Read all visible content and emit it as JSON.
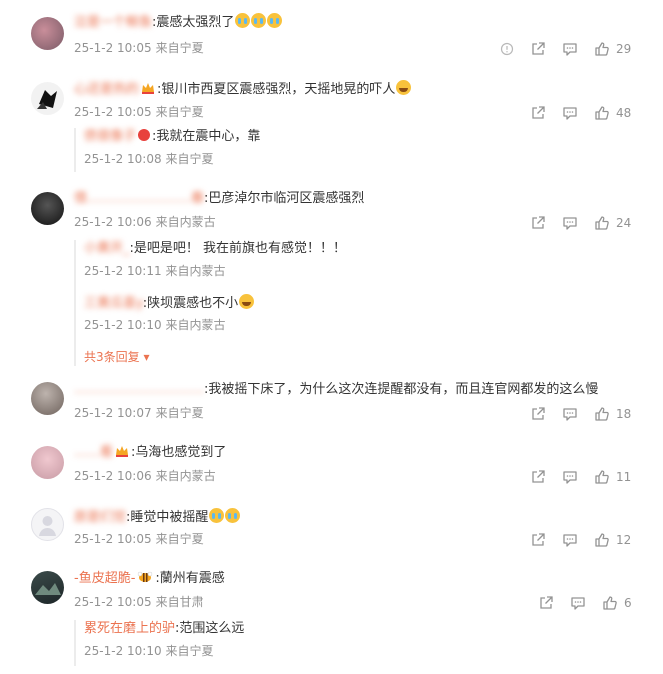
{
  "comments": [
    {
      "user": "泣是一个鲸鱼",
      "text": ":震感太强烈了",
      "emojis": [
        "cry-emoji",
        "cry-emoji",
        "cry-emoji"
      ],
      "time": "25-1-2 10:05",
      "source": "来自宁夏",
      "likes": "29",
      "has_report": true
    },
    {
      "user": "心还是热的",
      "badge": "crown-icon",
      "text": ":银川市西夏区震感强烈，天摇地晃的吓人",
      "emojis": [
        "laugh-cry-emoji"
      ],
      "time": "25-1-2 10:05",
      "source": "来自宁夏",
      "likes": "48",
      "replies": [
        {
          "user": "债很像子",
          "badge": "vip-red-icon",
          "text": ":我就在震中心，靠",
          "time": "25-1-2 10:08",
          "source": "来自宁夏"
        }
      ]
    },
    {
      "user": "借……………………春",
      "text": ":巴彦淖尔市临河区震感强烈",
      "time": "25-1-2 10:06",
      "source": "来自内蒙古",
      "likes": "24",
      "replies": [
        {
          "user": "小黄开_",
          "text": ":是吧是吧！ 我在前旗也有感觉！！！",
          "time": "25-1-2 10:11",
          "source": "来自内蒙古"
        },
        {
          "user": "三黄瓜喜y",
          "text": ":陕坝震感也不小",
          "emojis": [
            "laugh-cry-emoji"
          ],
          "time": "25-1-2 10:10",
          "source": "来自内蒙古"
        }
      ],
      "more_replies": "共3条回复"
    },
    {
      "user": "…………………………",
      "text": ":我被摇下床了，为什么这次连提醒都没有，而且连官网都发的这么慢",
      "time": "25-1-2 10:07",
      "source": "来自宁夏",
      "likes": "18"
    },
    {
      "user": "……看",
      "badge": "crown-icon",
      "text": ":乌海也感觉到了",
      "time": "25-1-2 10:06",
      "source": "来自内蒙古",
      "likes": "11"
    },
    {
      "user": "原是们觉",
      "text": ":睡觉中被摇醒",
      "emojis": [
        "cry-emoji",
        "cry-emoji"
      ],
      "time": "25-1-2 10:05",
      "source": "来自宁夏",
      "likes": "12"
    },
    {
      "user": "-鱼皮超脆-",
      "badge": "bee-icon",
      "text": ":蘭州有震感",
      "time": "25-1-2 10:05",
      "source": "来自甘肃",
      "likes": "6",
      "replies": [
        {
          "user": "累死在磨上的驴",
          "text": ":范围这么远",
          "time": "25-1-2 10:10",
          "source": "来自宁夏"
        }
      ]
    }
  ],
  "colors": {
    "username": "#eb7350",
    "meta": "#939393",
    "text": "#333333"
  }
}
